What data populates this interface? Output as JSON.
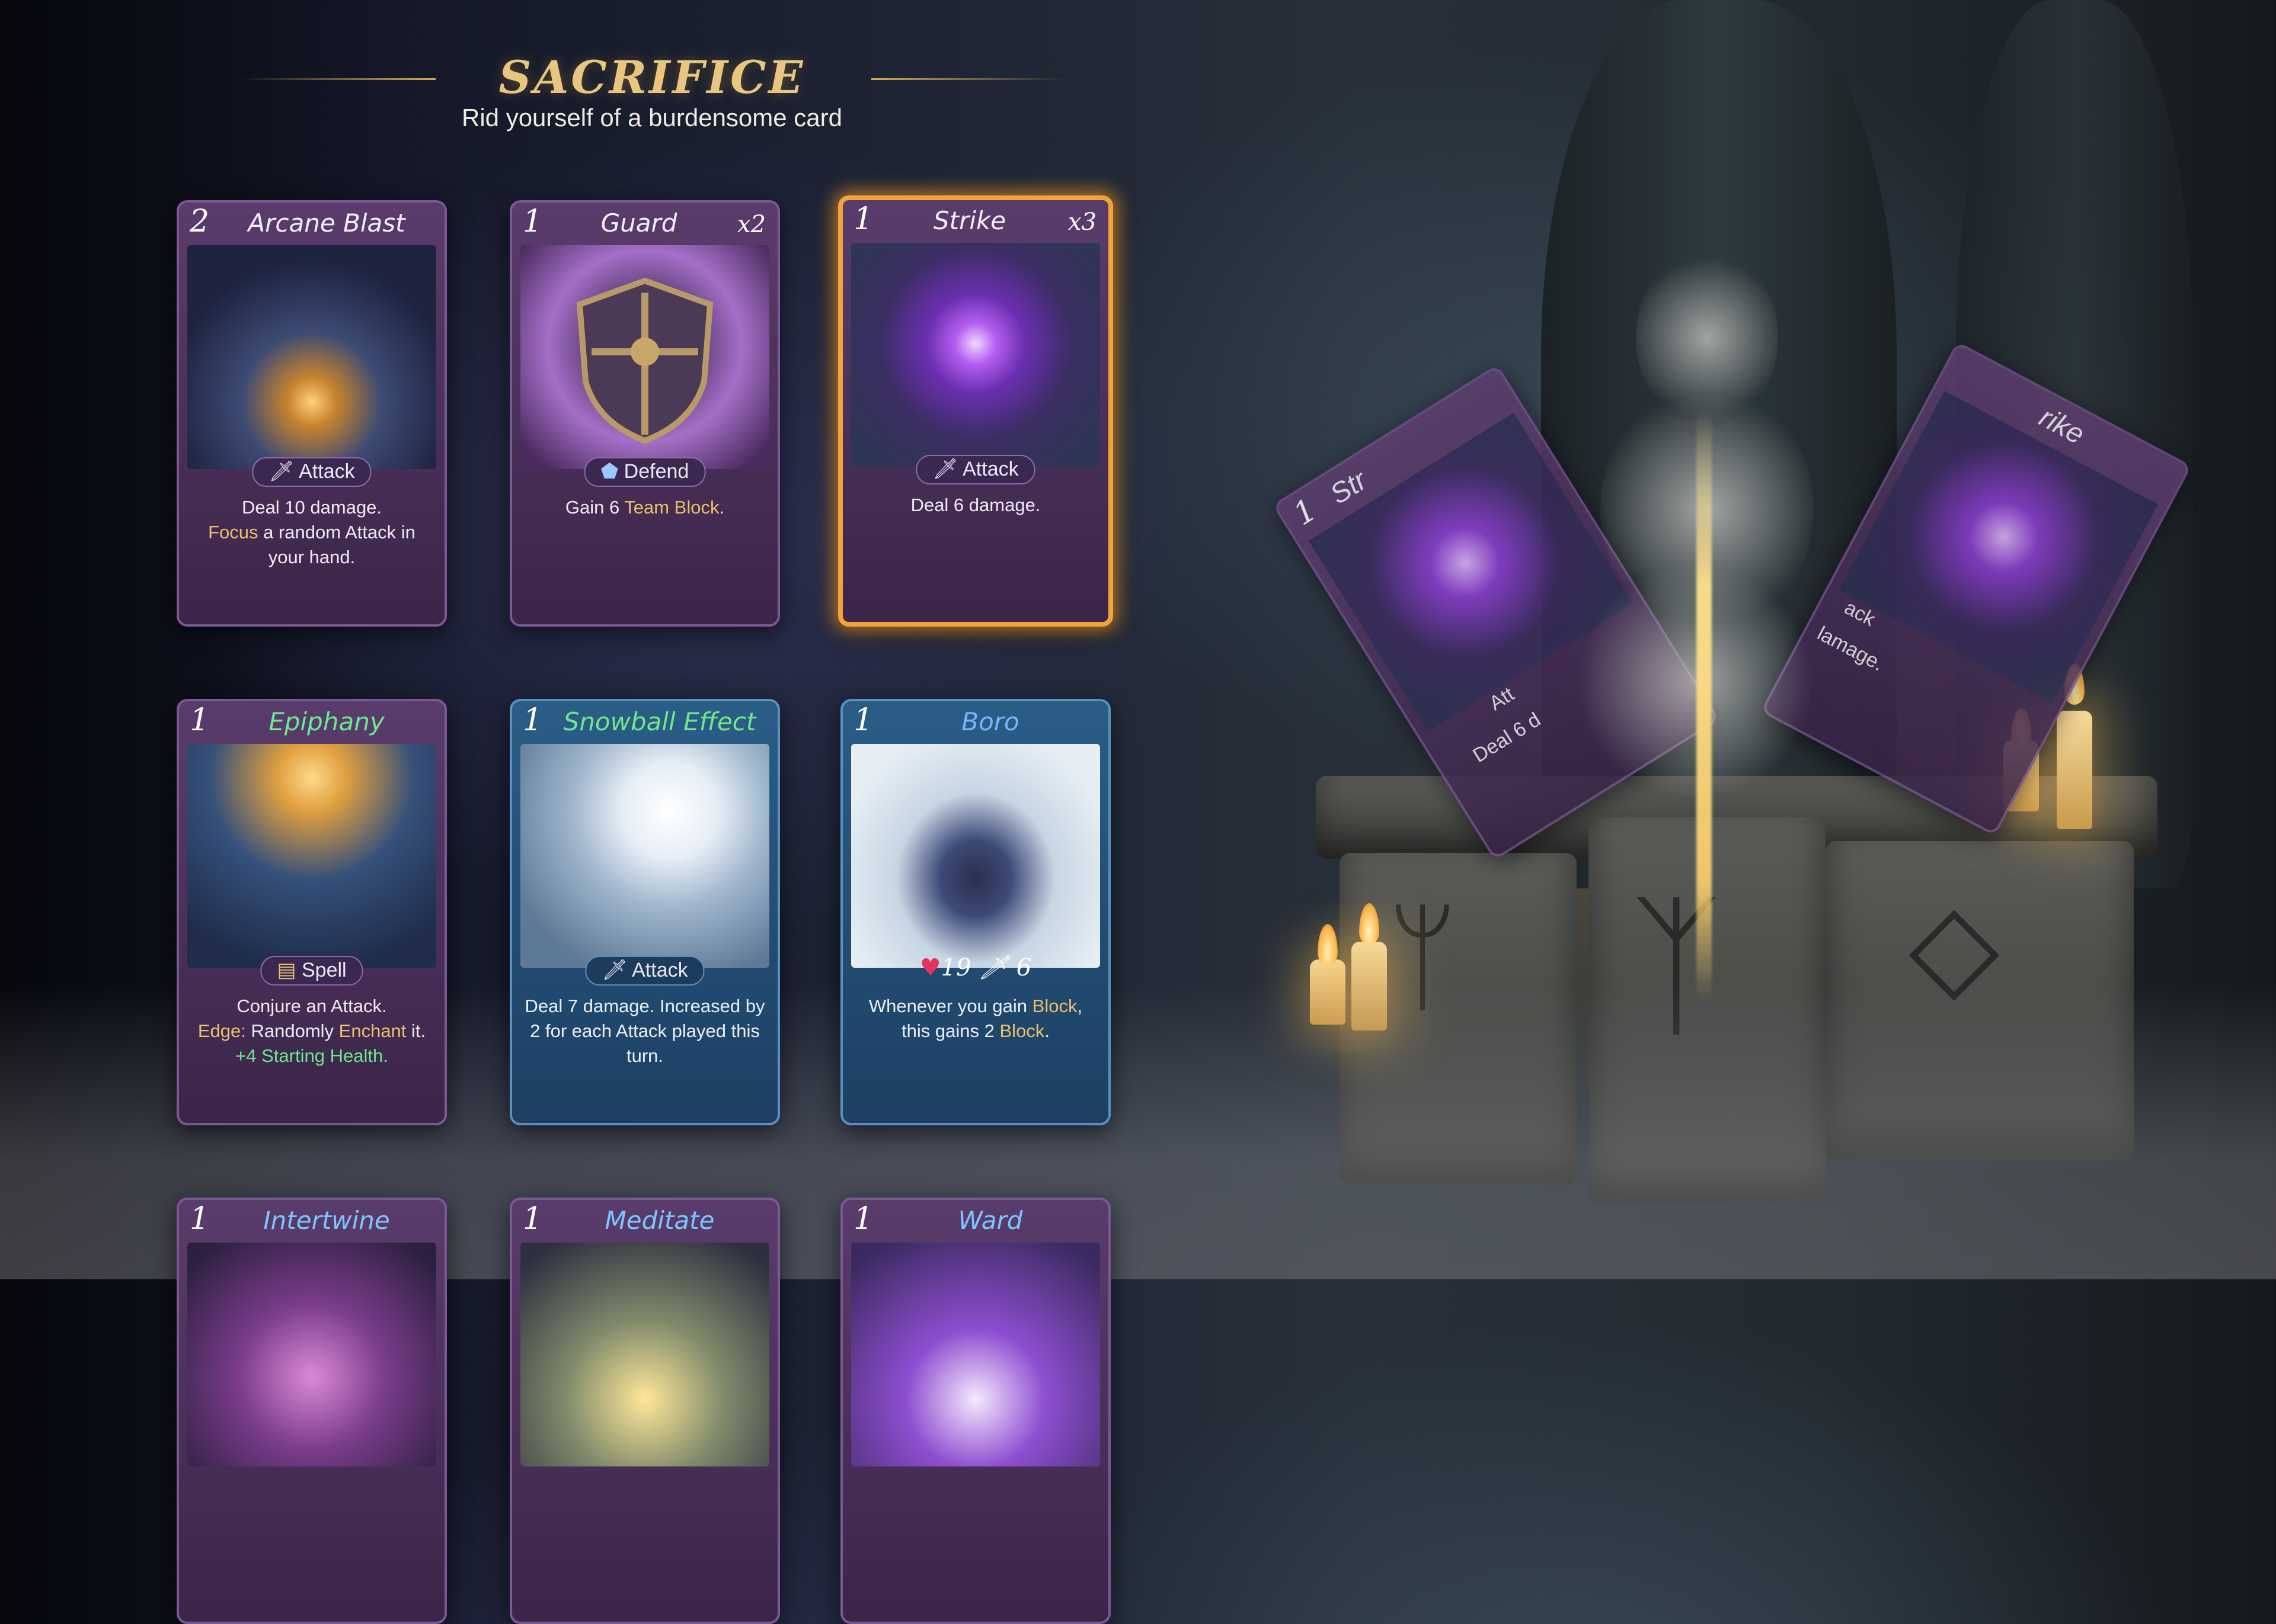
{
  "header": {
    "title": "SACRIFICE",
    "subtitle": "Rid yourself of a burdensome card"
  },
  "cards": [
    {
      "cost": "2",
      "name": "Arcane Blast",
      "count": "",
      "tag": "Attack",
      "tag_icon": "sword-icon",
      "desc": [
        {
          "t": "Deal 10 damage."
        },
        {
          "t": "Focus",
          "hl": true
        },
        {
          "t": " a random Attack in your hand."
        }
      ]
    },
    {
      "cost": "1",
      "name": "Guard",
      "count": "x2",
      "tag": "Defend",
      "tag_icon": "shield-icon",
      "desc": [
        {
          "t": "Gain 6 "
        },
        {
          "t": "Team Block",
          "hl": true
        },
        {
          "t": "."
        }
      ]
    },
    {
      "cost": "1",
      "name": "Strike",
      "count": "x3",
      "tag": "Attack",
      "tag_icon": "sword-icon",
      "selected": true,
      "desc": [
        {
          "t": "Deal 6 damage."
        }
      ]
    },
    {
      "cost": "1",
      "name": "Epiphany",
      "count": "",
      "tag": "Spell",
      "tag_icon": "scroll-icon",
      "desc": [
        {
          "t": "Conjure an Attack."
        },
        {
          "t": "Edge:",
          "hl": true
        },
        {
          "t": " Randomly "
        },
        {
          "t": "Enchant",
          "hl": true
        },
        {
          "t": " it."
        },
        {
          "t": "+4 Starting Health.",
          "green": true
        }
      ]
    },
    {
      "cost": "1",
      "name": "Snowball Effect",
      "count": "",
      "tag": "Attack",
      "tag_icon": "sword-icon",
      "desc": [
        {
          "t": "Deal 7 damage. Increased by 2 for each Attack played this turn."
        }
      ]
    },
    {
      "cost": "1",
      "name": "Boro",
      "count": "",
      "health": "19",
      "attack": "6",
      "desc": [
        {
          "t": "Whenever you gain "
        },
        {
          "t": "Block",
          "hl": true
        },
        {
          "t": ", this gains 2 "
        },
        {
          "t": "Block",
          "hl": true
        },
        {
          "t": "."
        }
      ]
    },
    {
      "cost": "1",
      "name": "Intertwine",
      "count": ""
    },
    {
      "cost": "1",
      "name": "Meditate",
      "count": ""
    },
    {
      "cost": "1",
      "name": "Ward",
      "count": ""
    }
  ],
  "sacrifice_preview": {
    "left_card": {
      "cost": "1",
      "name": "Str",
      "tag": "Att",
      "desc": "Deal 6 d"
    },
    "right_card": {
      "name": "rike",
      "tag": "ack",
      "desc": "lamage."
    }
  },
  "colors": {
    "accent": "#e9c680",
    "selected_border": "#f1a43a",
    "highlight": "#e8c16a",
    "green": "#6ee88e"
  }
}
